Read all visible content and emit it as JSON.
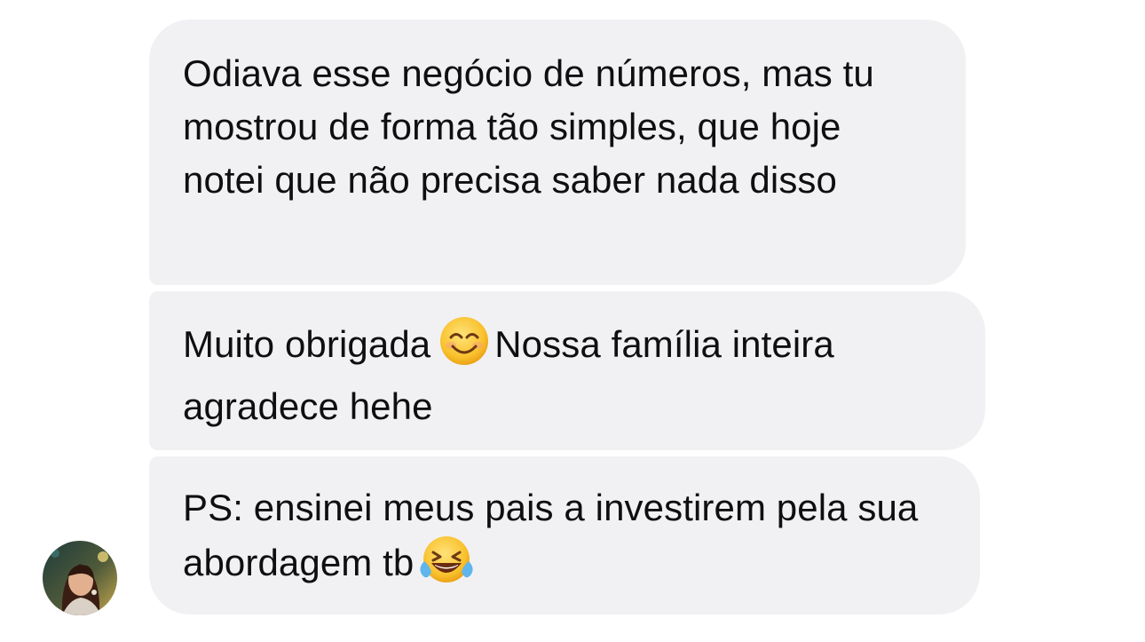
{
  "messages": [
    {
      "text": "Odiava esse negócio de números, mas tu mostrou de forma tão simples, que hoje notei que não precisa saber nada disso"
    },
    {
      "text_before_emoji": "Muito obrigada",
      "emoji": "smiling-face-emoji",
      "text_after_emoji": "Nossa família inteira agradece hehe"
    },
    {
      "text_before_emoji": "PS: ensinei meus pais a investirem pela sua abordagem tb",
      "emoji": "face-with-tears-of-joy-emoji"
    }
  ],
  "colors": {
    "bubble_background": "#f1f1f4",
    "text": "#0f0f10",
    "page_background": "#ffffff"
  }
}
